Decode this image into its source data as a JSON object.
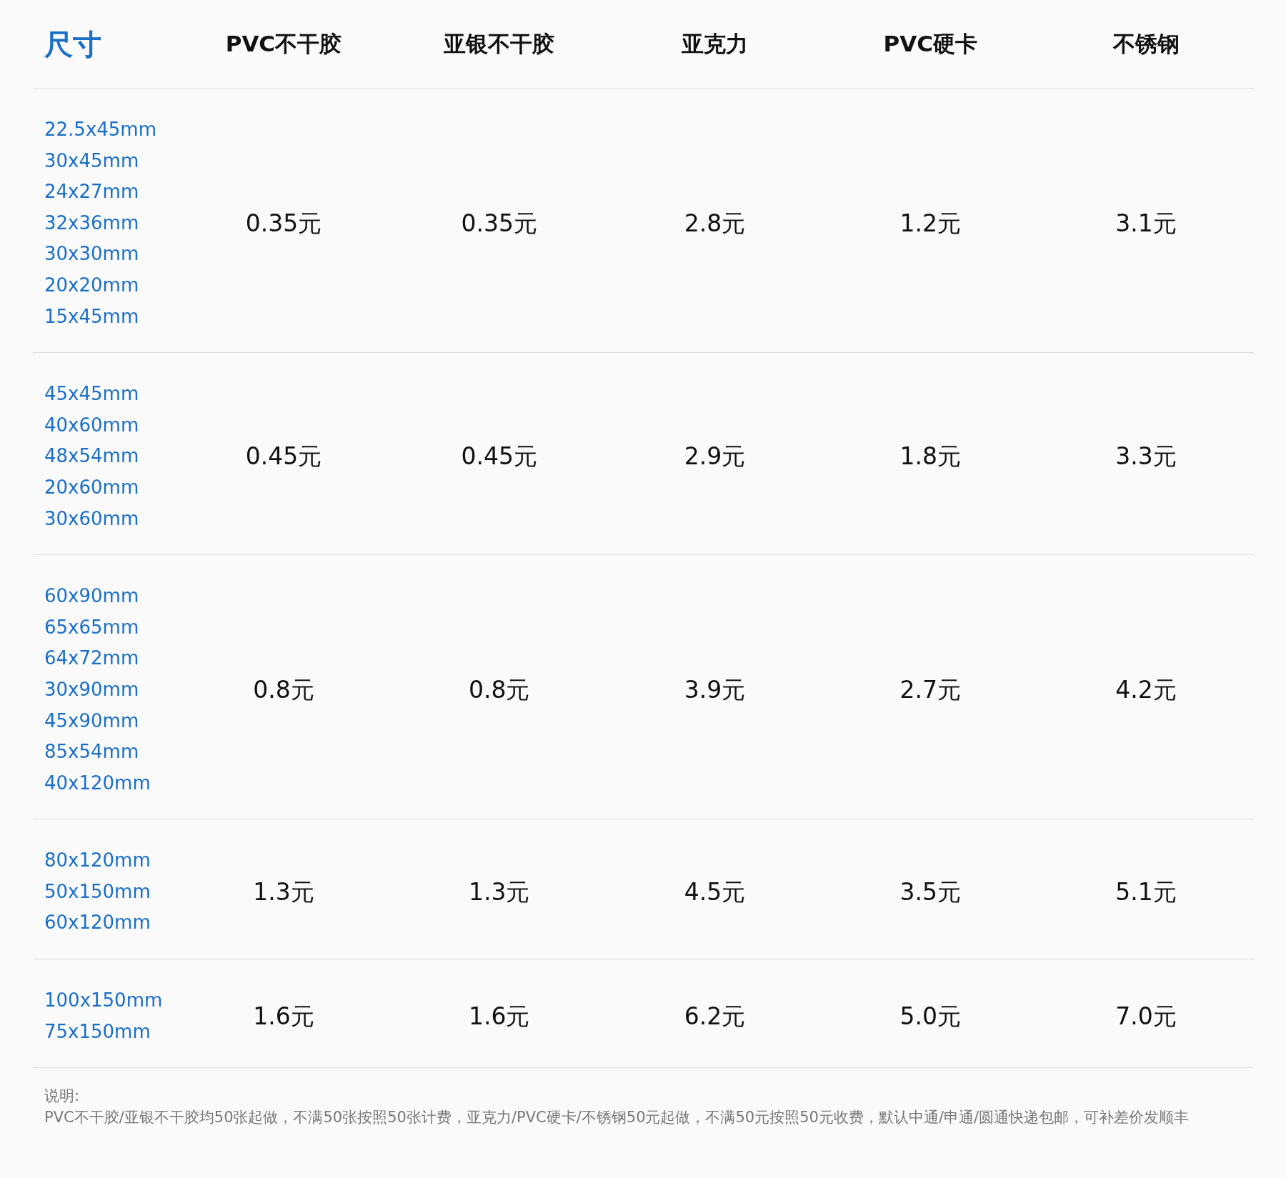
{
  "table": {
    "columns": [
      "尺寸",
      "PVC不干胶",
      "亚银不干胶",
      "亚克力",
      "PVC硬卡",
      "不锈钢"
    ],
    "rows": [
      {
        "sizes": [
          "22.5x45mm",
          "30x45mm",
          "24x27mm",
          "32x36mm",
          "30x30mm",
          "20x20mm",
          "15x45mm"
        ],
        "prices": [
          "0.35元",
          "0.35元",
          "2.8元",
          "1.2元",
          "3.1元"
        ]
      },
      {
        "sizes": [
          "45x45mm",
          "40x60mm",
          "48x54mm",
          "20x60mm",
          "30x60mm"
        ],
        "prices": [
          "0.45元",
          "0.45元",
          "2.9元",
          "1.8元",
          "3.3元"
        ]
      },
      {
        "sizes": [
          "60x90mm",
          "65x65mm",
          "64x72mm",
          "30x90mm",
          "45x90mm",
          "85x54mm",
          "40x120mm"
        ],
        "prices": [
          "0.8元",
          "0.8元",
          "3.9元",
          "2.7元",
          "4.2元"
        ]
      },
      {
        "sizes": [
          "80x120mm",
          "50x150mm",
          "60x120mm"
        ],
        "prices": [
          "1.3元",
          "1.3元",
          "4.5元",
          "3.5元",
          "5.1元"
        ]
      },
      {
        "sizes": [
          "100x150mm",
          "75x150mm"
        ],
        "prices": [
          "1.6元",
          "1.6元",
          "6.2元",
          "5.0元",
          "7.0元"
        ]
      }
    ]
  },
  "note": {
    "title": "说明:",
    "text": "PVC不干胶/亚银不干胶均50张起做，不满50张按照50张计费，亚克力/PVC硬卡/不锈钢50元起做，不满50元按照50元收费，默认中通/申通/圆通快递包邮，可补差价发顺丰"
  }
}
